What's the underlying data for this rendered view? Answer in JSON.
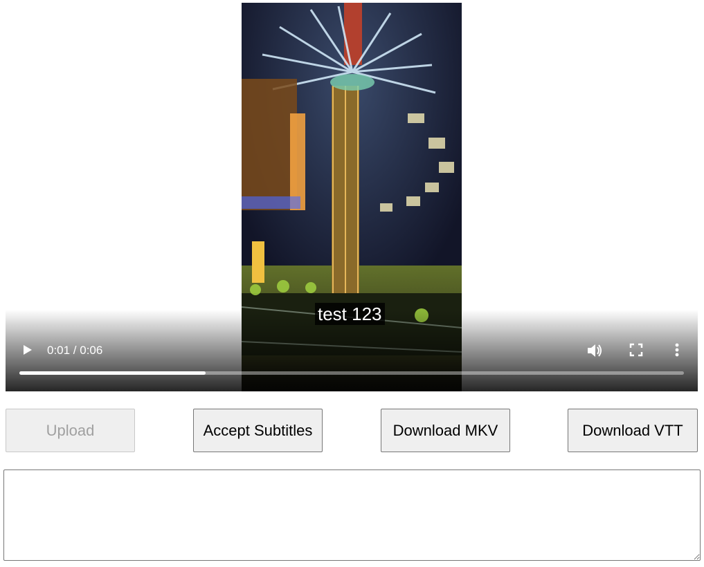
{
  "video": {
    "subtitle": "test 123",
    "time_display": "0:01 / 0:06",
    "progress_fraction": 0.28,
    "controls": {
      "play_icon": "play-icon",
      "volume_icon": "volume-icon",
      "fullscreen_icon": "fullscreen-icon",
      "more_icon": "more-options-icon"
    }
  },
  "buttons": {
    "upload": "Upload",
    "accept_subtitles": "Accept Subtitles",
    "download_mkv": "Download MKV",
    "download_vtt": "Download VTT"
  },
  "editor": {
    "value": "",
    "placeholder": ""
  }
}
